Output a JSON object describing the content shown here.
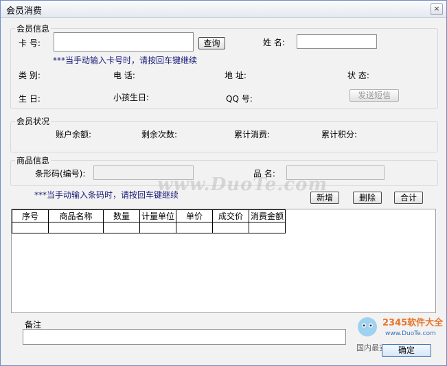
{
  "window": {
    "title": "会员消费",
    "close_glyph": "×"
  },
  "member_info": {
    "group_label": "会员信息",
    "card_label": "卡  号:",
    "card_value": "",
    "query_button": "查询",
    "name_label": "姓  名:",
    "name_value": "",
    "card_hint": "***当手动输入卡号时，请按回车键继续",
    "category_label": "类  别:",
    "phone_label": "电  话:",
    "address_label": "地  址:",
    "status_label": "状  态:",
    "birthday_label": "生  日:",
    "child_birthday_label": "小孩生日:",
    "qq_label": "QQ 号:",
    "sms_button": "发送短信"
  },
  "member_status": {
    "group_label": "会员状况",
    "balance_label": "账户余额:",
    "remaining_label": "剩余次数:",
    "total_spend_label": "累计消费:",
    "total_points_label": "累计积分:"
  },
  "product_info": {
    "group_label": "商品信息",
    "barcode_label": "条形码(编号):",
    "barcode_value": "",
    "product_name_label": "品  名:",
    "product_name_value": "",
    "barcode_hint": "***当手动输入条码时，请按回车键继续",
    "add_button": "新增",
    "delete_button": "删除",
    "total_button": "合计"
  },
  "grid": {
    "columns": [
      "序号",
      "商品名称",
      "数量",
      "计量单位",
      "单价",
      "成交价",
      "消费金额"
    ],
    "rows": [
      [
        "",
        "",
        "",
        "",
        "",
        "",
        ""
      ]
    ]
  },
  "remarks": {
    "label": "备注",
    "value": ""
  },
  "confirm_button": "确定",
  "watermark": {
    "text": "www.DuoTe.com"
  },
  "logo": {
    "brand": "2345软件大全",
    "site": "www.DuoTe.com",
    "caption": "国内最安全的软件站"
  }
}
